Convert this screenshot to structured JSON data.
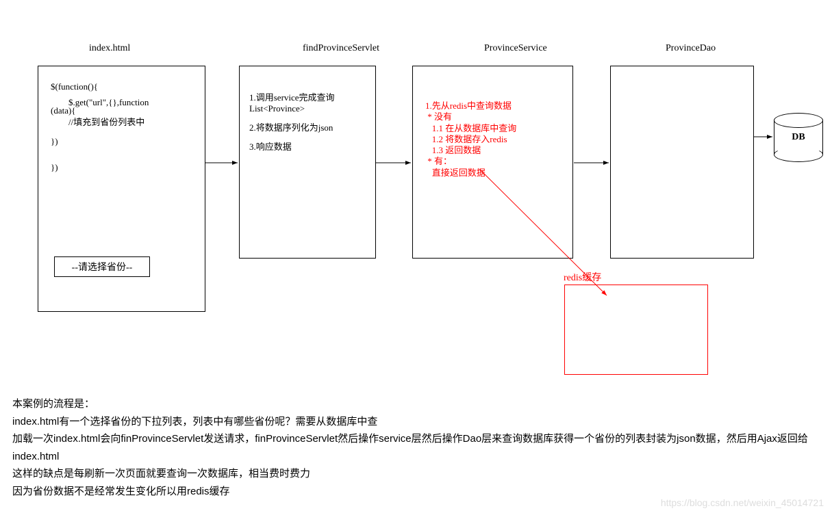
{
  "titles": {
    "index": "index.html",
    "servlet": "findProvinceServlet",
    "service": "ProvinceService",
    "dao": "ProvinceDao"
  },
  "index_code": {
    "l1": "$(function(){",
    "l2": "        $.get(\"url\",{},function",
    "l3": "(data){",
    "l4": "        //填充到省份列表中",
    "l5": "})",
    "l6": "})"
  },
  "dropdown": "--请选择省份--",
  "servlet_text": {
    "l1": "1.调用service完成查询",
    "l2": "List<Province>",
    "l3": "2.将数据序列化为json",
    "l4": "3.响应数据"
  },
  "service_text": {
    "l1": "1.先从redis中查询数据",
    "l2": " * 没有",
    "l3": "   1.1 在从数据库中查询",
    "l4": "   1.2 将数据存入redis",
    "l5": "   1.3 返回数据",
    "l6": " * 有：",
    "l7": "   直接返回数据"
  },
  "redis_label": "redis缓存",
  "db_label": "DB",
  "paragraph": {
    "p0": "本案例的流程是：",
    "p1": "index.html有一个选择省份的下拉列表，列表中有哪些省份呢？需要从数据库中查",
    "p2": "加载一次index.html会向finProvinceServlet发送请求，finProvinceServlet然后操作service层然后操作Dao层来查询数据库获得一个省份的列表封装为json数据，然后用Ajax返回给index.html",
    "p3": "这样的缺点是每刷新一次页面就要查询一次数据库，相当费时费力",
    "p4": "因为省份数据不是经常发生变化所以用redis缓存"
  },
  "watermark": "https://blog.csdn.net/weixin_45014721"
}
